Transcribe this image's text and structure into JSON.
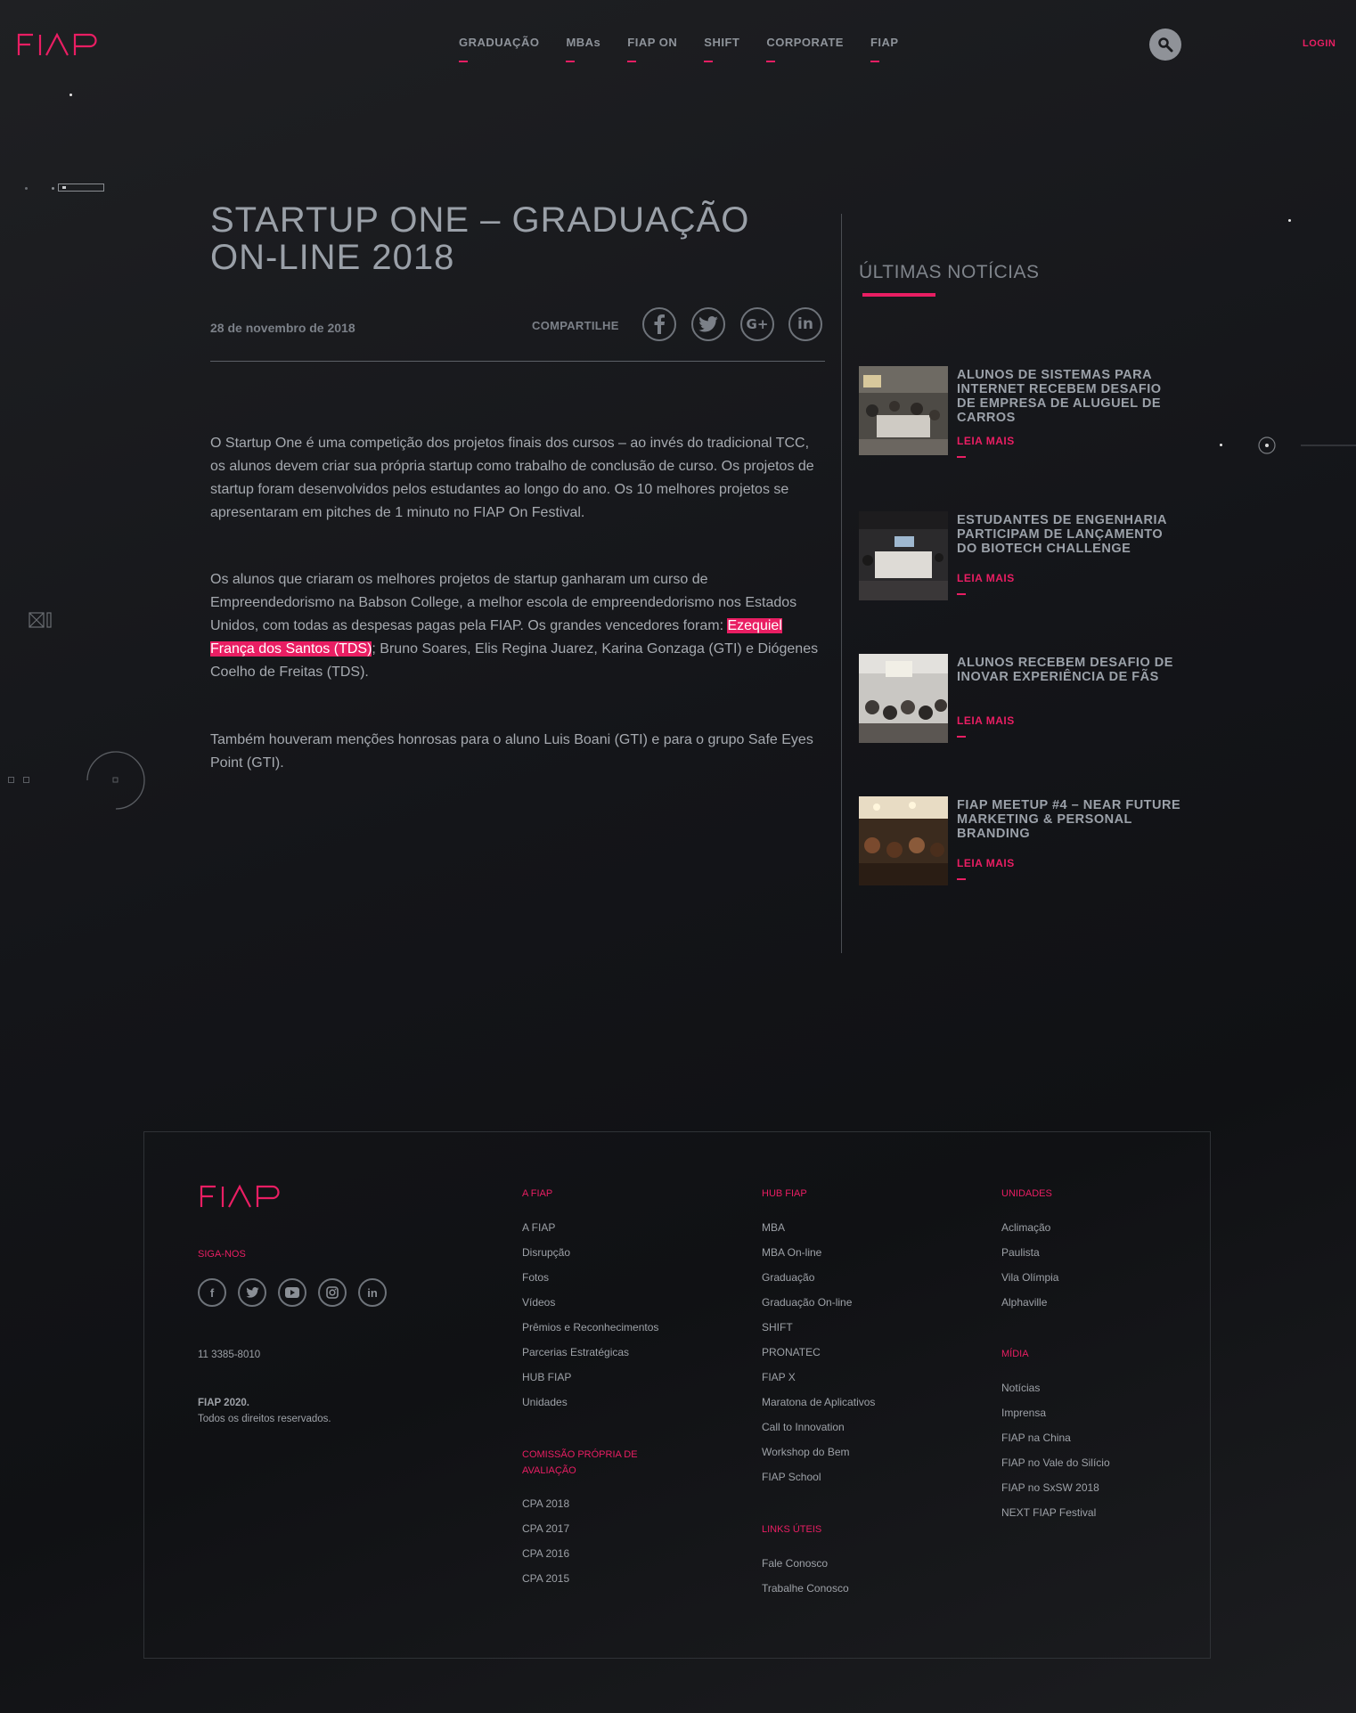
{
  "brand": {
    "name": "FIAP",
    "accent": "#e91e63"
  },
  "header": {
    "nav": [
      "GRADUAÇÃO",
      "MBAs",
      "FIAP ON",
      "SHIFT",
      "CORPORATE",
      "FIAP"
    ],
    "login": "LOGIN",
    "search_icon": "search-icon"
  },
  "article": {
    "title": "STARTUP ONE – GRADUAÇÃO ON-LINE 2018",
    "date": "28 de novembro de 2018",
    "share_label": "COMPARTILHE",
    "share_icons": [
      "facebook-icon",
      "twitter-icon",
      "google-plus-icon",
      "linkedin-icon"
    ],
    "p1": "O Startup One é uma competição dos projetos finais dos cursos – ao invés do tradicional TCC, os alunos devem criar sua própria startup como trabalho de conclusão de curso. Os projetos de startup foram desenvolvidos pelos estudantes ao longo do ano.  Os 10 melhores projetos se apresentaram em pitches de 1 minuto no FIAP On Festival.",
    "p2_before": "Os alunos que criaram os melhores projetos de startup ganharam um curso de Empreendedorismo na Babson College, a melhor escola de empreendedorismo nos Estados Unidos, com todas as despesas pagas pela FIAP. Os grandes vencedores foram: ",
    "p2_highlight": "Ezequiel França dos Santos (TDS)",
    "p2_after": "; Bruno Soares, Elis Regina Juarez, Karina Gonzaga (GTI) e Diógenes Coelho de Freitas (TDS).",
    "p3": "Também houveram menções honrosas para o aluno Luis Boani (GTI) e para o grupo Safe Eyes Point (GTI)."
  },
  "sidebar": {
    "title": "ÚLTIMAS NOTÍCIAS",
    "news": [
      {
        "title": "ALUNOS DE SISTEMAS PARA INTERNET RECEBEM DESAFIO DE EMPRESA DE ALUGUEL DE CARROS",
        "more": "LEIA MAIS"
      },
      {
        "title": "ESTUDANTES DE ENGENHARIA PARTICIPAM DE LANÇAMENTO DO BIOTECH CHALLENGE",
        "more": "LEIA MAIS"
      },
      {
        "title": "ALUNOS RECEBEM DESAFIO DE INOVAR EXPERIÊNCIA DE FÃS",
        "more": "LEIA MAIS"
      },
      {
        "title": "FIAP MEETUP #4 – NEAR FUTURE MARKETING & PERSONAL BRANDING",
        "more": "LEIA MAIS"
      }
    ]
  },
  "footer": {
    "follow": "SIGA-NOS",
    "social_icons": [
      "facebook-icon",
      "twitter-icon",
      "youtube-icon",
      "instagram-icon",
      "linkedin-icon"
    ],
    "phone": "11 3385-8010",
    "copyright_title": "FIAP 2020.",
    "copyright_text": "Todos os direitos reservados.",
    "col_fiap": {
      "title": "A FIAP",
      "links": [
        "A FIAP",
        "Disrupção",
        "Fotos",
        "Vídeos",
        "Prêmios e Reconhecimentos",
        "Parcerias Estratégicas",
        "HUB FIAP",
        "Unidades"
      ]
    },
    "col_cpa": {
      "title": "COMISSÃO PRÓPRIA DE AVALIAÇÃO",
      "links": [
        "CPA 2018",
        "CPA 2017",
        "CPA 2016",
        "CPA 2015"
      ]
    },
    "col_hub": {
      "title": "HUB FIAP",
      "links": [
        "MBA",
        "MBA On-line",
        "Graduação",
        "Graduação On-line",
        "SHIFT",
        "PRONATEC",
        "FIAP X",
        "Maratona de Aplicativos",
        "Call to Innovation",
        "Workshop do Bem",
        "FIAP School"
      ]
    },
    "col_links": {
      "title": "LINKS ÚTEIS",
      "links": [
        "Fale Conosco",
        "Trabalhe Conosco"
      ]
    },
    "col_units": {
      "title": "UNIDADES",
      "links": [
        "Aclimação",
        "Paulista",
        "Vila Olímpia",
        "Alphaville"
      ]
    },
    "col_media": {
      "title": "MÍDIA",
      "links": [
        "Notícias",
        "Imprensa",
        "FIAP na China",
        "FIAP no Vale do Silício",
        "FIAP no SxSW 2018",
        "NEXT FIAP Festival"
      ]
    }
  }
}
